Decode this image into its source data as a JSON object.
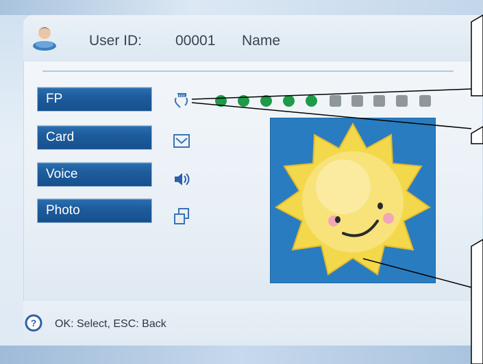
{
  "header": {
    "user_id_label": "User ID:",
    "user_id_value": "00001",
    "name_label": "Name"
  },
  "menu": {
    "items": [
      {
        "label": "FP",
        "icon": "fingerprint-hand-icon"
      },
      {
        "label": "Card",
        "icon": "card-icon"
      },
      {
        "label": "Voice",
        "icon": "speaker-icon"
      },
      {
        "label": "Photo",
        "icon": "photo-icon"
      }
    ]
  },
  "fingerprint_progress": {
    "enrolled": 5,
    "total": 10
  },
  "photo": {
    "subject": "smiling-sun-icon"
  },
  "footer": {
    "hint": "OK: Select, ESC: Back"
  },
  "colors": {
    "accent_blue": "#1e5c9c",
    "dot_on": "#1e9a49",
    "dot_off": "#8f969c",
    "photo_bg": "#2a7cc0"
  }
}
